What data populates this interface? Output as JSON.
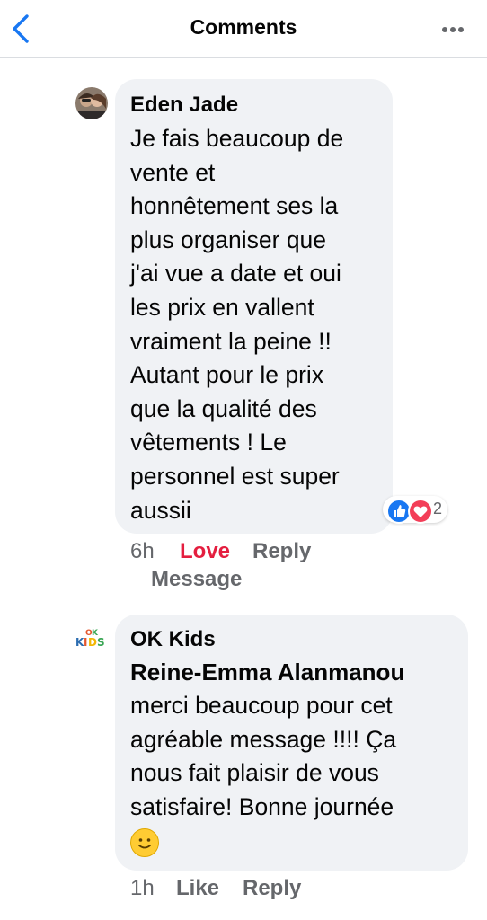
{
  "header": {
    "title": "Comments"
  },
  "comments": [
    {
      "author": "Eden Jade",
      "text": "Je fais beaucoup de\nvente et\nhonnêtement ses la\nplus organiser que\nj'ai vue a date et oui\nles prix en vallent\nvraiment la peine !!\nAutant pour le prix\nque la qualité des\nvêtements ! Le\npersonnel est super\naussii",
      "reactions": {
        "icons": [
          "like-icon",
          "love-icon"
        ],
        "count": "2"
      },
      "time": "6h",
      "actions": [
        "Love",
        "Reply",
        "Message"
      ]
    },
    {
      "author": "OK Kids",
      "avatar_text": "OK KIDS",
      "mention": "Reine-Emma Alanmanou",
      "text": "merci beaucoup pour cet\nagréable message !!!! Ça\nnous fait plaisir de vous\nsatisfaire! Bonne journée",
      "emoji": "slightly-smiling-face",
      "time": "1h",
      "actions": [
        "Like",
        "Reply"
      ]
    }
  ],
  "colors": {
    "accent": "#1877f2",
    "love": "#e41e3f",
    "bubble": "#f0f2f5",
    "secondary_text": "#65676b"
  }
}
